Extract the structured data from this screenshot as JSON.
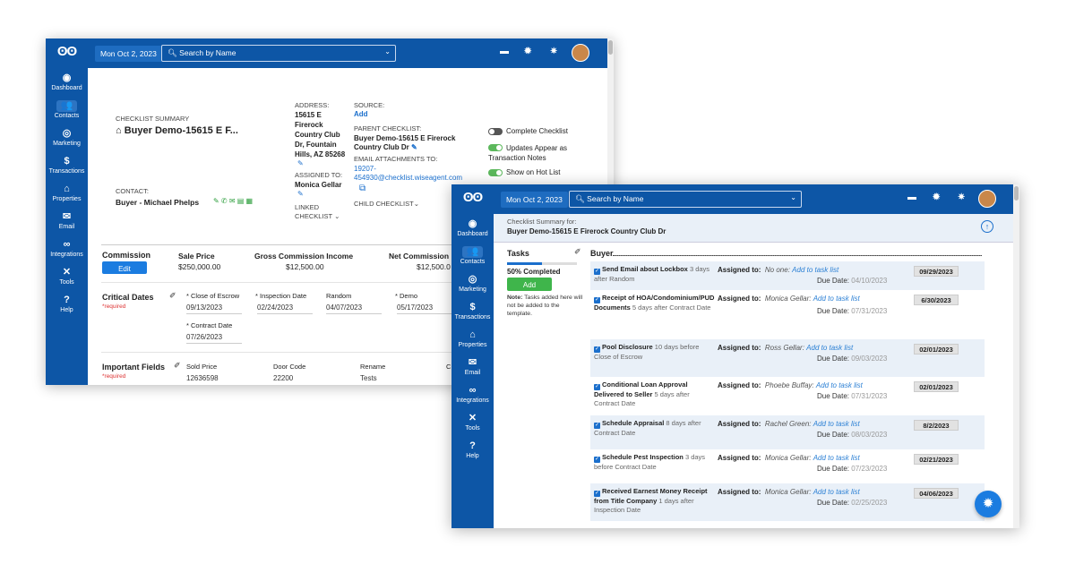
{
  "nav": {
    "logo": "ʘʘ",
    "items": [
      {
        "label": "Dashboard",
        "icon": "◉"
      },
      {
        "label": "Contacts",
        "icon": "👥"
      },
      {
        "label": "Marketing",
        "icon": "◎"
      },
      {
        "label": "Transactions",
        "icon": "$"
      },
      {
        "label": "Properties",
        "icon": "⌂"
      },
      {
        "label": "Email",
        "icon": "✉"
      },
      {
        "label": "Integrations",
        "icon": "∞"
      },
      {
        "label": "Tools",
        "icon": "✕"
      },
      {
        "label": "Help",
        "icon": "?"
      }
    ]
  },
  "header": {
    "date": "Mon Oct 2, 2023",
    "search_placeholder": "Search by Name",
    "chevron": "⌄",
    "chat_icon": "▬",
    "gear_icon": "✹",
    "bug_icon": "✷"
  },
  "checklist": {
    "summary_label": "CHECKLIST SUMMARY",
    "title": "Buyer Demo-15615 E F...",
    "home_icon": "⌂",
    "contact_label": "CONTACT:",
    "contact_name": "Buyer - Michael Phelps",
    "contact_icons": "✎ ✆ ✉ ▤ ▦",
    "address_label": "ADDRESS:",
    "address_l1": "15615 E",
    "address_l2": "Firerock",
    "address_l3": "Country Club",
    "address_l4": "Dr, Fountain",
    "address_l5": "Hills, AZ 85268",
    "assigned_label": "ASSIGNED TO:",
    "assigned_l1": "Monica Gellar",
    "linked_label": "LINKED",
    "linked_label2": "CHECKLIST",
    "source_label": "SOURCE:",
    "source_value": "Add",
    "parent_label": "PARENT CHECKLIST:",
    "parent_l1": "Buyer Demo-15615 E Firerock",
    "parent_l2": "Country Club Dr",
    "attach_label": "EMAIL ATTACHMENTS TO:",
    "attach_l1": "19207-",
    "attach_l2": "454930@checklist.wiseagent.com",
    "child_label": "CHILD CHECKLIST",
    "complete_label": "Complete Checklist",
    "updates_l1": "Updates Appear as",
    "updates_l2": "Transaction Notes",
    "hotlist_label": "Show on Hot List",
    "commission_label": "Commission",
    "edit_label": "Edit",
    "sale_label": "Sale Price",
    "sale_value": "$250,000.00",
    "gross_label": "Gross Commission Income",
    "gross_value": "$12,500.00",
    "net_label": "Net Commission",
    "net_value": "$12,500.0",
    "critical_label": "Critical Dates",
    "required": "*required",
    "close_label": "* Close of Escrow",
    "close_value": "09/13/2023",
    "insp_label": "* Inspection Date",
    "insp_value": "02/24/2023",
    "random_label": "Random",
    "random_value": "04/07/2023",
    "demo_label": "* Demo",
    "demo_value": "05/17/2023",
    "contract_label": "* Contract Date",
    "contract_value": "07/26/2023",
    "important_label": "Important Fields",
    "sold_label": "Sold Price",
    "sold_value": "12636598",
    "door_label": "Door Code",
    "door_value": "22200",
    "rename_label": "Rename",
    "rename_value": "Tests",
    "c_label": "C"
  },
  "tasks": {
    "summary_for": "Checklist Summary for:",
    "summary_title": "Buyer Demo-15615 E Firerock Country Club Dr",
    "tasks_label": "Tasks",
    "progress_pct": 50,
    "completed": "50% Completed",
    "add_label": "Add",
    "note_bold": "Note:",
    "note_text": " Tasks added here will not be added to the template.",
    "group_label": "Buyer",
    "assigned_prefix": "Assigned to:",
    "due_prefix": "Due Date:",
    "items": [
      {
        "title": "Send Email about Lockbox",
        "sub": " 3 days after Random",
        "who": "No one:",
        "link": "Add to task list",
        "due": "04/10/2023",
        "badge": "09/29/2023"
      },
      {
        "title": "Receipt of HOA/Condominium/PUD Documents",
        "sub": " 5 days after Contract Date",
        "who": "Monica Gellar:",
        "link": "Add to task list",
        "due": "07/31/2023",
        "badge": "6/30/2023"
      },
      {
        "title": "Pool Disclosure",
        "sub": " 10 days before Close of Escrow",
        "who": "Ross Gellar:",
        "link": "Add to task list",
        "due": "09/03/2023",
        "badge": "02/01/2023"
      },
      {
        "title": "Conditional Loan Approval Delivered to Seller",
        "sub": " 5 days after Contract Date",
        "who": "Phoebe Buffay:",
        "link": "Add to task list",
        "due": "07/31/2023",
        "badge": "02/01/2023"
      },
      {
        "title": "Schedule Appraisal",
        "sub": " 8 days after Contract Date",
        "who": "Rachel Green:",
        "link": "Add to task list",
        "due": "08/03/2023",
        "badge": "8/2/2023"
      },
      {
        "title": "Schedule Pest Inspection",
        "sub": " 3 days before Contract Date",
        "who": "Monica Gellar:",
        "link": "Add to task list",
        "due": "07/23/2023",
        "badge": "02/21/2023"
      },
      {
        "title": "Received Earnest Money Receipt from Title Company",
        "sub": " 1 days after Inspection Date",
        "who": "Monica Gellar:",
        "link": "Add to task list",
        "due": "02/25/2023",
        "badge": "04/06/2023"
      }
    ]
  }
}
